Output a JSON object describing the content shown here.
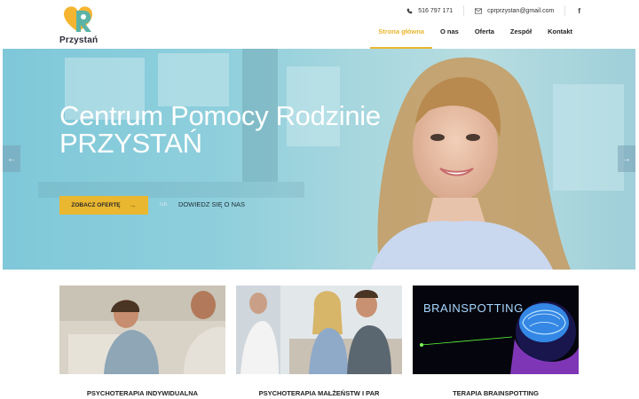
{
  "brand": {
    "name": "Przystań",
    "colors": {
      "yellow": "#f5b531",
      "teal": "#5bb3a6",
      "accent": "#e9b730"
    }
  },
  "topbar": {
    "phone_icon": "phone-icon",
    "phone": "516 797 171",
    "email_icon": "mail-icon",
    "email": "cprprzystan@gmail.com",
    "social": "f"
  },
  "nav": {
    "items": [
      {
        "label": "Strona główna",
        "active": true
      },
      {
        "label": "O nas"
      },
      {
        "label": "Oferta"
      },
      {
        "label": "Zespół"
      },
      {
        "label": "Kontakt"
      }
    ]
  },
  "hero": {
    "title_line1": "Centrum Pomocy Rodzinie",
    "title_line2": "PRZYSTAŃ",
    "offer_button": "ZOBACZ OFERTĘ",
    "offer_arrow": "→",
    "or": "lub",
    "learn_more": "DOWIEDZ SIĘ O NAS",
    "prev": "←",
    "next": "→"
  },
  "cards": [
    {
      "label": "PSYCHOTERAPIA INDYWIDUALNA"
    },
    {
      "label": "PSYCHOTERAPIA MAŁŻEŃSTW I PAR"
    },
    {
      "label": "TERAPIA BRAINSPOTTING",
      "image_text": "BRAINSPOTTING"
    }
  ]
}
